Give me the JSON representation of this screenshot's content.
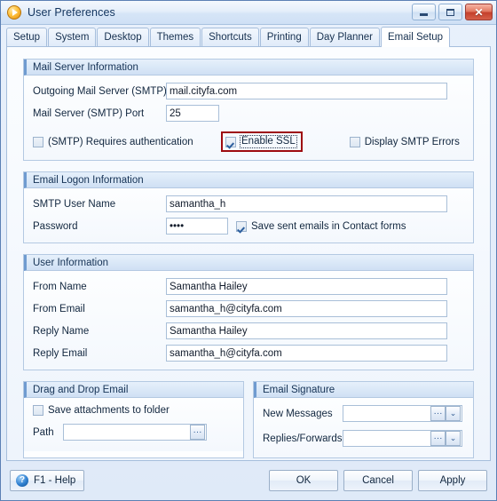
{
  "window": {
    "title": "User Preferences",
    "icon": "play-circle-icon",
    "controls": {
      "minimize": "minimize-icon",
      "maximize": "maximize-icon",
      "close": "✕"
    }
  },
  "tabs": [
    {
      "label": "Setup",
      "active": false
    },
    {
      "label": "System",
      "active": false
    },
    {
      "label": "Desktop",
      "active": false
    },
    {
      "label": "Themes",
      "active": false
    },
    {
      "label": "Shortcuts",
      "active": false
    },
    {
      "label": "Printing",
      "active": false
    },
    {
      "label": "Day Planner",
      "active": false
    },
    {
      "label": "Email Setup",
      "active": true
    }
  ],
  "mail_server": {
    "title": "Mail Server Information",
    "smtp_label": "Outgoing Mail Server (SMTP)",
    "smtp_value": "mail.cityfa.com",
    "port_label": "Mail Server (SMTP) Port",
    "port_value": "25",
    "requires_auth_label": "(SMTP) Requires authentication",
    "requires_auth_checked": false,
    "enable_ssl_label": "Enable SSL",
    "enable_ssl_checked": true,
    "enable_ssl_highlight_color": "#9e0b10",
    "display_errors_label": "Display SMTP Errors",
    "display_errors_checked": false
  },
  "email_logon": {
    "title": "Email Logon Information",
    "username_label": "SMTP User Name",
    "username_value": "samantha_h",
    "password_label": "Password",
    "password_value": "••••",
    "save_sent_label": "Save sent emails in Contact forms",
    "save_sent_checked": true
  },
  "user_information": {
    "title": "User Information",
    "fields": [
      {
        "label": "From Name",
        "value": "Samantha Hailey"
      },
      {
        "label": "From Email",
        "value": "samantha_h@cityfa.com"
      },
      {
        "label": "Reply Name",
        "value": "Samantha Hailey"
      },
      {
        "label": "Reply Email",
        "value": "samantha_h@cityfa.com"
      }
    ]
  },
  "drag_drop": {
    "title": "Drag and Drop Email",
    "save_attachments_label": "Save attachments to folder",
    "save_attachments_checked": false,
    "path_label": "Path",
    "path_value": "",
    "browse_label": "···"
  },
  "email_signature": {
    "title": "Email Signature",
    "new_messages_label": "New Messages",
    "new_messages_value": "",
    "replies_label": "Replies/Forwards",
    "replies_value": "",
    "browse_label": "···",
    "dropdown_glyph": "⌄"
  },
  "footer": {
    "help_label": "F1 - Help",
    "help_icon_glyph": "?",
    "ok_label": "OK",
    "cancel_label": "Cancel",
    "apply_label": "Apply"
  }
}
